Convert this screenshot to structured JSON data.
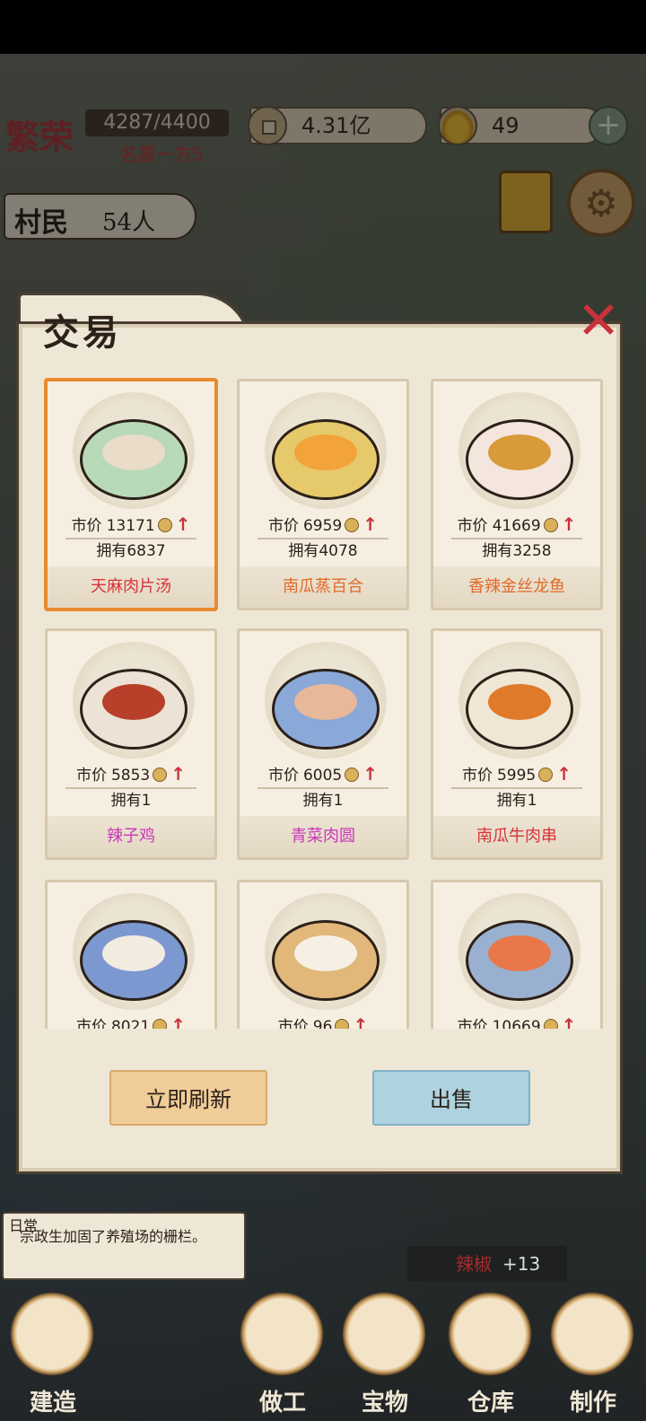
{
  "hud": {
    "prosperity_label": "繁荣",
    "prosperity_value": "4287/4400",
    "prosperity_rank": "名震一方5",
    "coins": "4.31亿",
    "ingots": "49",
    "plus": "+",
    "villager_label": "村民",
    "villager_count": "54人"
  },
  "modal": {
    "title": "交易",
    "close": "✕",
    "refresh_label": "立即刷新",
    "sell_label": "出售"
  },
  "labels": {
    "price_prefix": "市价",
    "own_prefix": "拥有"
  },
  "items": [
    {
      "name": "天麻肉片汤",
      "price": "13171",
      "owned": "6837",
      "name_color": "#d8333a",
      "bowl": "#b8d9b8",
      "food": "#e9dcc8",
      "trend": "up"
    },
    {
      "name": "南瓜蒸百合",
      "price": "6959",
      "owned": "4078",
      "name_color": "#e06a2a",
      "bowl": "#e6c96a",
      "food": "#f2a33a",
      "trend": "up"
    },
    {
      "name": "香辣金丝龙鱼",
      "price": "41669",
      "owned": "3258",
      "name_color": "#e06a2a",
      "bowl": "#f4e6dc",
      "food": "#d99a3a",
      "trend": "up"
    },
    {
      "name": "辣子鸡",
      "price": "5853",
      "owned": "1",
      "name_color": "#c838b8",
      "bowl": "#ece2d5",
      "food": "#b8402a",
      "trend": "up"
    },
    {
      "name": "青菜肉圆",
      "price": "6005",
      "owned": "1",
      "name_color": "#c838b8",
      "bowl": "#8aa8d8",
      "food": "#e8b89a",
      "trend": "up"
    },
    {
      "name": "南瓜牛肉串",
      "price": "5995",
      "owned": "1",
      "name_color": "#d8333a",
      "bowl": "#efe6d3",
      "food": "#e07a2a",
      "trend": "up"
    },
    {
      "name": "",
      "price": "8021",
      "owned": "",
      "name_color": "#d8333a",
      "bowl": "#7c98d0",
      "food": "#f2ece0",
      "trend": "up"
    },
    {
      "name": "",
      "price": "96",
      "owned": "",
      "name_color": "#d8333a",
      "bowl": "#e2b77a",
      "food": "#f6f0e4",
      "trend": "up"
    },
    {
      "name": "",
      "price": "10669",
      "owned": "",
      "name_color": "#d8333a",
      "bowl": "#9ab0d0",
      "food": "#e8784a",
      "trend": "up"
    }
  ],
  "log": {
    "tag": "日常",
    "text": "宗政生加固了养殖场的栅栏。"
  },
  "gain": {
    "item": "辣椒",
    "amount": "+13"
  },
  "nav": [
    {
      "label": "建造"
    },
    {
      "label": "做工"
    },
    {
      "label": "宝物"
    },
    {
      "label": "仓库"
    },
    {
      "label": "制作"
    }
  ]
}
